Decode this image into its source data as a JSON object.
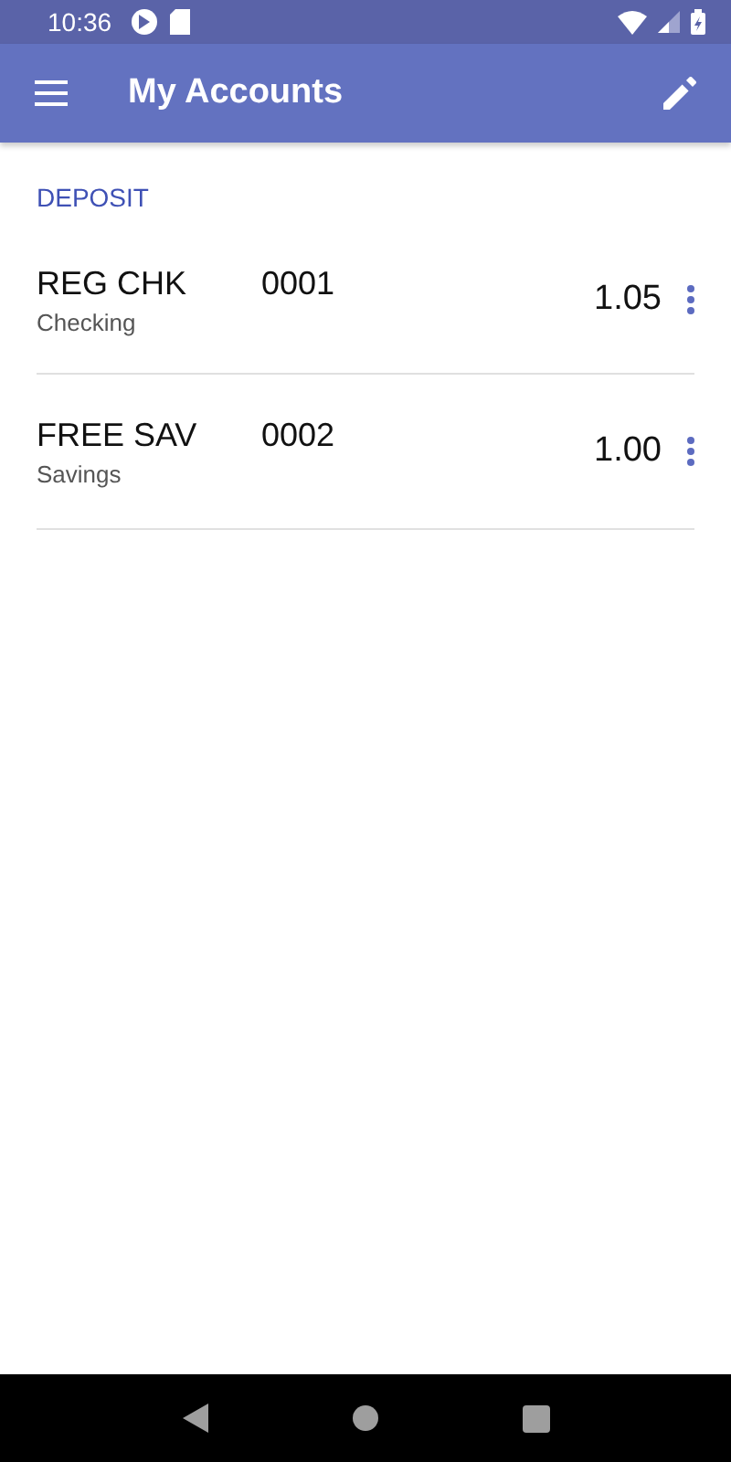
{
  "status_bar": {
    "time": "10:36"
  },
  "app_bar": {
    "title": "My Accounts"
  },
  "section": {
    "title": "DEPOSIT"
  },
  "accounts": [
    {
      "name": "REG CHK",
      "number": "0001",
      "type": "Checking",
      "balance": "1.05"
    },
    {
      "name": "FREE SAV",
      "number": "0002",
      "type": "Savings",
      "balance": "1.00"
    }
  ]
}
